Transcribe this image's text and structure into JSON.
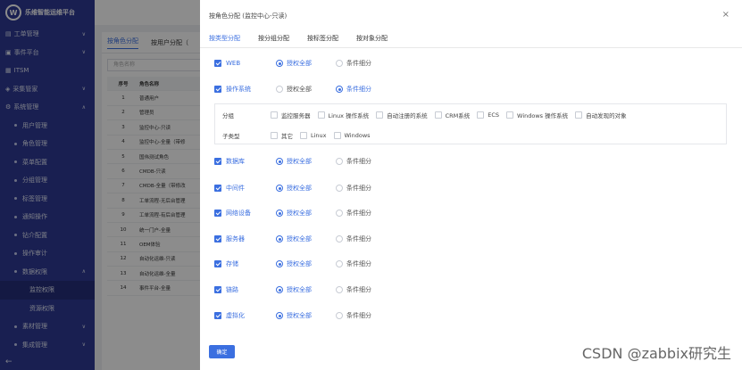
{
  "sidebar": {
    "logo_text": "W",
    "brand": "乐维智能运维平台",
    "items": [
      {
        "label": "工单管理",
        "icon": "ticket-icon",
        "caret": "∨"
      },
      {
        "label": "事件平台",
        "icon": "event-icon",
        "caret": "∨"
      },
      {
        "label": "ITSM",
        "icon": "itsm-icon",
        "caret": ""
      },
      {
        "label": "采集管家",
        "icon": "collect-icon",
        "caret": "∨"
      },
      {
        "label": "系统管理",
        "icon": "settings-icon",
        "caret": "∧"
      },
      {
        "label": "用户管理"
      },
      {
        "label": "角色管理"
      },
      {
        "label": "菜单配置"
      },
      {
        "label": "分组管理"
      },
      {
        "label": "标签管理"
      },
      {
        "label": "通知操作"
      },
      {
        "label": "钻介配置"
      },
      {
        "label": "操作审计"
      },
      {
        "label": "数据权限",
        "caret": "∧"
      },
      {
        "label": "监控权限"
      },
      {
        "label": "资源权限"
      },
      {
        "label": "素材管理",
        "caret": "∨"
      },
      {
        "label": "集成管理",
        "caret": "∨"
      }
    ],
    "collapse": "←"
  },
  "background": {
    "tabs": [
      "按角色分配",
      "按用户分配（"
    ],
    "search_placeholder": "角色名称",
    "table_headers": [
      "序号",
      "角色名称"
    ],
    "rows": [
      [
        "1",
        "普通用户"
      ],
      [
        "2",
        "管理员"
      ],
      [
        "3",
        "监控中心-只读"
      ],
      [
        "4",
        "监控中心-全量（带修"
      ],
      [
        "5",
        "国伟测试角色"
      ],
      [
        "6",
        "CMDB-只读"
      ],
      [
        "7",
        "CMDB-全量（带修改"
      ],
      [
        "8",
        "工单流程-无后台管理"
      ],
      [
        "9",
        "工单流程-有后台管理"
      ],
      [
        "10",
        "统一门户-全量"
      ],
      [
        "11",
        "OEM体验"
      ],
      [
        "12",
        "自动化运维-只读"
      ],
      [
        "13",
        "自动化运维-全量"
      ],
      [
        "14",
        "事件平台-全量"
      ]
    ]
  },
  "drawer": {
    "title": "按角色分配 (监控中心-只读)",
    "close": "×",
    "tabs": [
      "按类型分配",
      "按分组分配",
      "按标签分配",
      "按对象分配"
    ],
    "radio_all": "授权全部",
    "radio_partial": "条件细分",
    "categories": [
      {
        "label": "WEB",
        "mode": "all"
      },
      {
        "label": "操作系统",
        "mode": "partial"
      },
      {
        "label": "数据库",
        "mode": "all"
      },
      {
        "label": "中间件",
        "mode": "all"
      },
      {
        "label": "网络设备",
        "mode": "all"
      },
      {
        "label": "服务器",
        "mode": "all"
      },
      {
        "label": "存储",
        "mode": "all"
      },
      {
        "label": "链路",
        "mode": "all"
      },
      {
        "label": "虚拟化",
        "mode": "all"
      }
    ],
    "detail": {
      "group_label": "分组",
      "group_options": [
        "监控服务器",
        "Linux 操作系统",
        "自动注册的系统",
        "CRM系统",
        "ECS",
        "Windows 操作系统",
        "自动发现的对象"
      ],
      "subtype_label": "子类型",
      "subtype_options": [
        "其它",
        "Linux",
        "Windows"
      ]
    },
    "confirm": "确定"
  },
  "watermark": "CSDN @zabbix研究生",
  "colors": {
    "accent": "#3b6fe0",
    "sidebar": "#2f3a94"
  }
}
